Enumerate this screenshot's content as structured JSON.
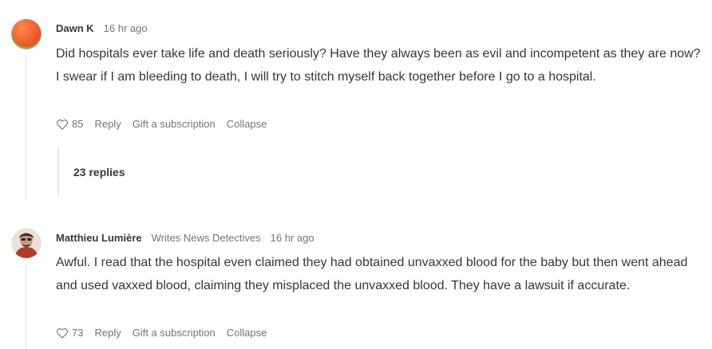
{
  "comments": [
    {
      "author": "Dawn K",
      "role": "",
      "time": "16 hr ago",
      "avatar_icon": "orange-gradient-avatar",
      "text": "Did hospitals ever take life and death seriously? Have they always been as evil and incompetent as they are now? I swear if I am bleeding to death, I will try to stitch myself back together before I go to a hospital.",
      "likes": "85",
      "reply_label": "Reply",
      "gift_label": "Gift a subscription",
      "collapse_label": "Collapse",
      "replies_label": "23 replies"
    },
    {
      "author": "Matthieu Lumière",
      "role": "Writes News Detectives",
      "time": "16 hr ago",
      "avatar_icon": "portrait-avatar",
      "text": "Awful. I read that the hospital even claimed they had obtained unvaxxed blood for the baby but then went ahead and used vaxxed blood, claiming they misplaced the unvaxxed blood. They have a lawsuit if accurate.",
      "likes": "73",
      "reply_label": "Reply",
      "gift_label": "Gift a subscription",
      "collapse_label": "Collapse"
    }
  ],
  "colors": {
    "text": "#363737",
    "muted": "#757575",
    "thread_line": "#e6e6e6",
    "avatar_orange": "#f26b3a"
  }
}
